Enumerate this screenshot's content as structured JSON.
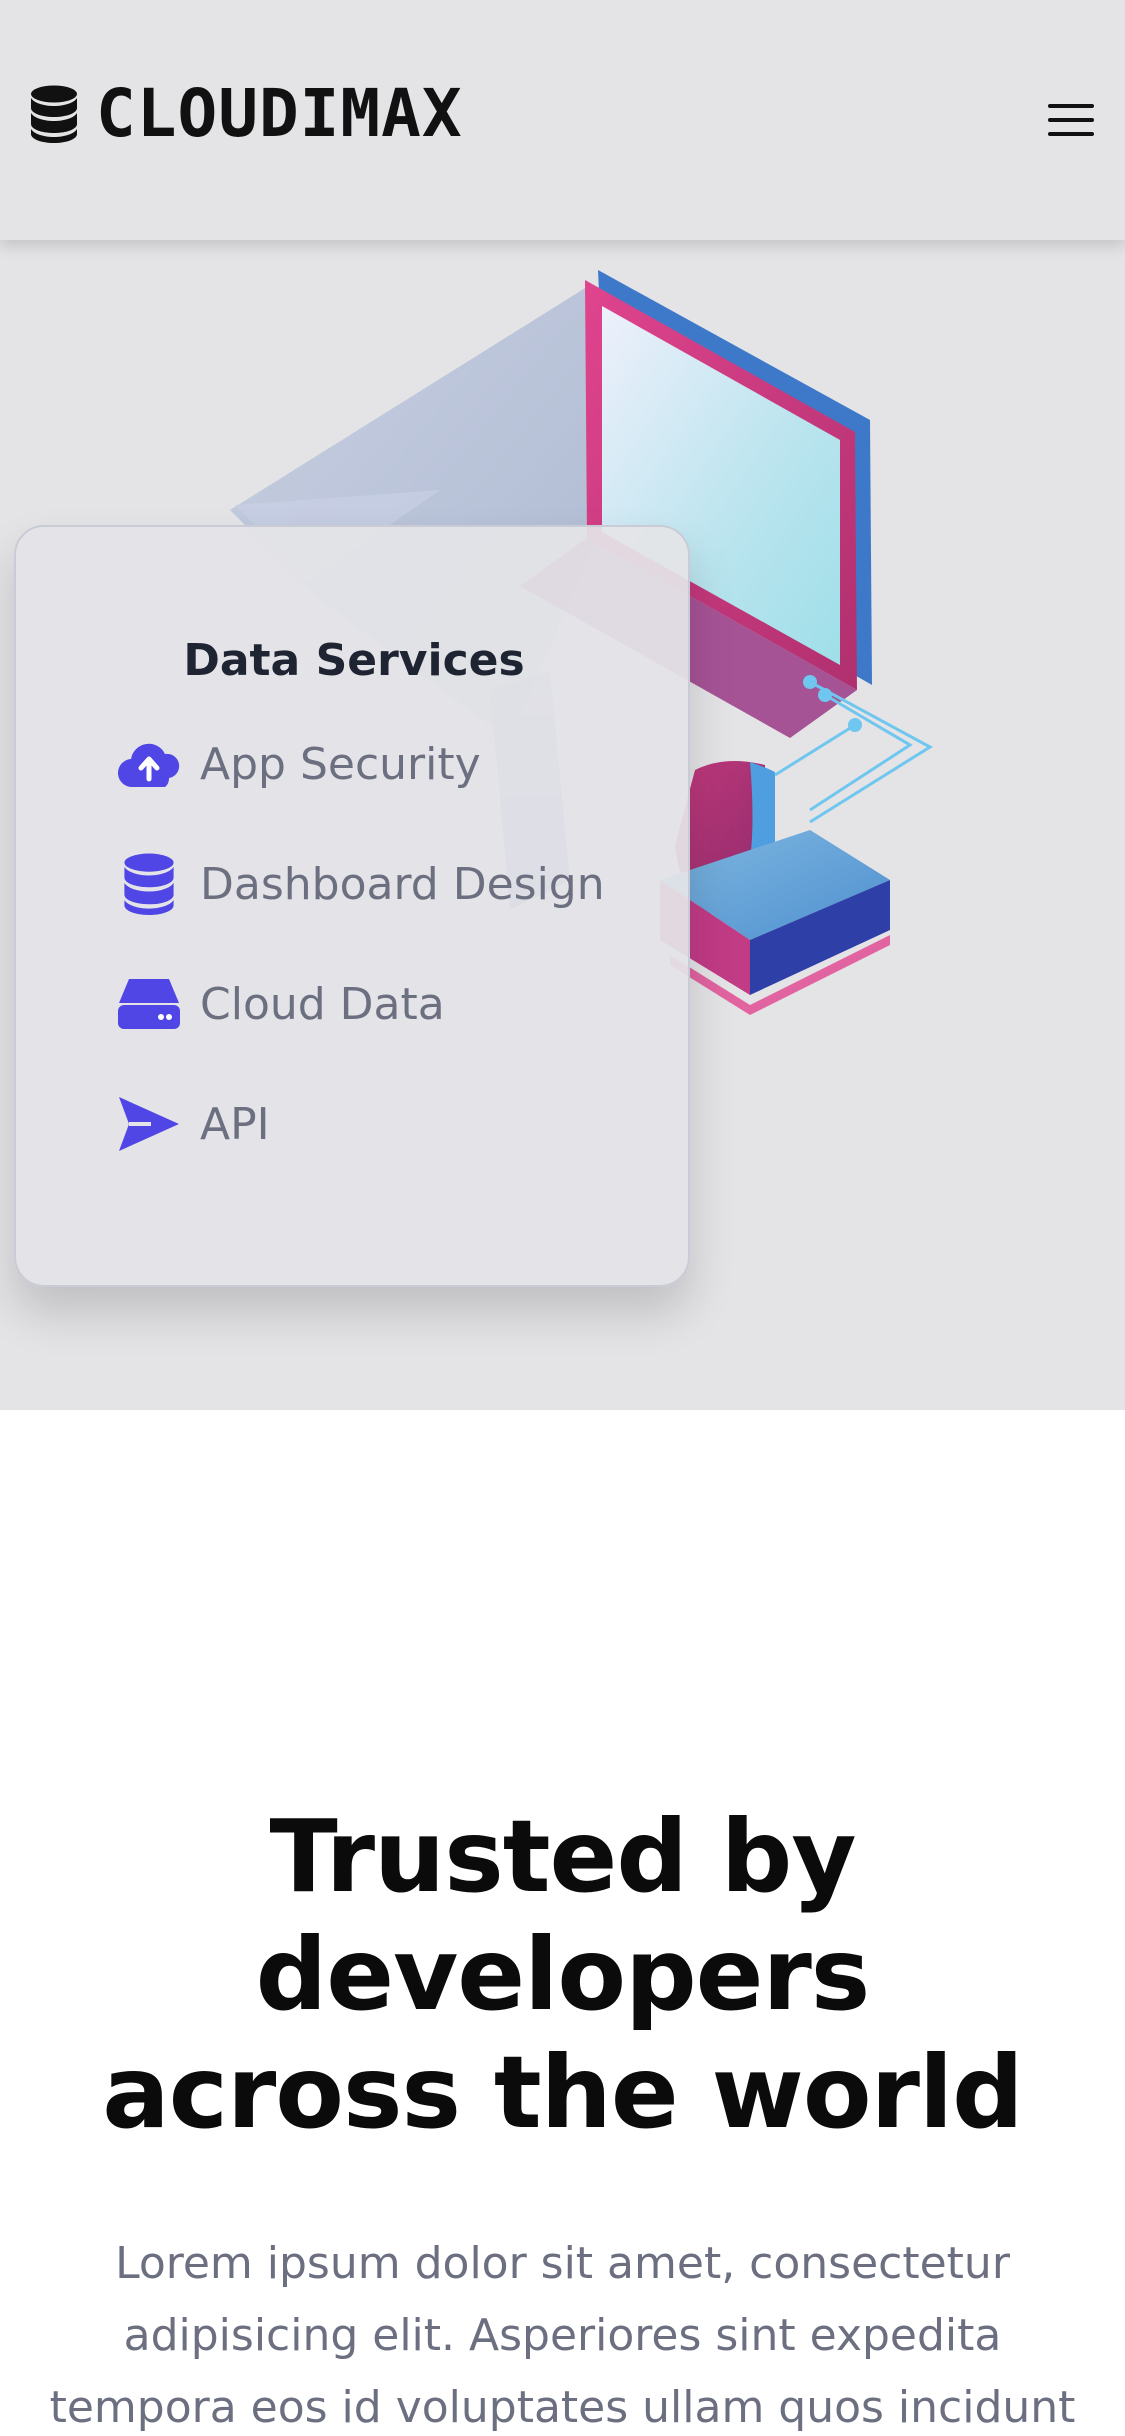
{
  "header": {
    "brand_name": "CLOUDIMAX",
    "brand_icon": "database-icon",
    "menu_icon": "hamburger-menu-icon"
  },
  "card": {
    "title": "Data Services",
    "services": [
      {
        "label": "App Security",
        "icon": "cloud-upload-icon"
      },
      {
        "label": "Dashboard Design",
        "icon": "database-icon"
      },
      {
        "label": "Cloud Data",
        "icon": "hard-drive-icon"
      },
      {
        "label": "API",
        "icon": "paper-plane-icon"
      }
    ]
  },
  "trusted": {
    "title": "Trusted by developers across the world",
    "description": "Lorem ipsum dolor sit amet, consectetur adipisicing elit. Asperiores sint expedita tempora eos id voluptates ullam quos incidunt"
  },
  "colors": {
    "accent": "#4f46e5",
    "header_bg": "#e4e4e7",
    "text_dark": "#111111",
    "text_muted": "#6b6f80"
  }
}
